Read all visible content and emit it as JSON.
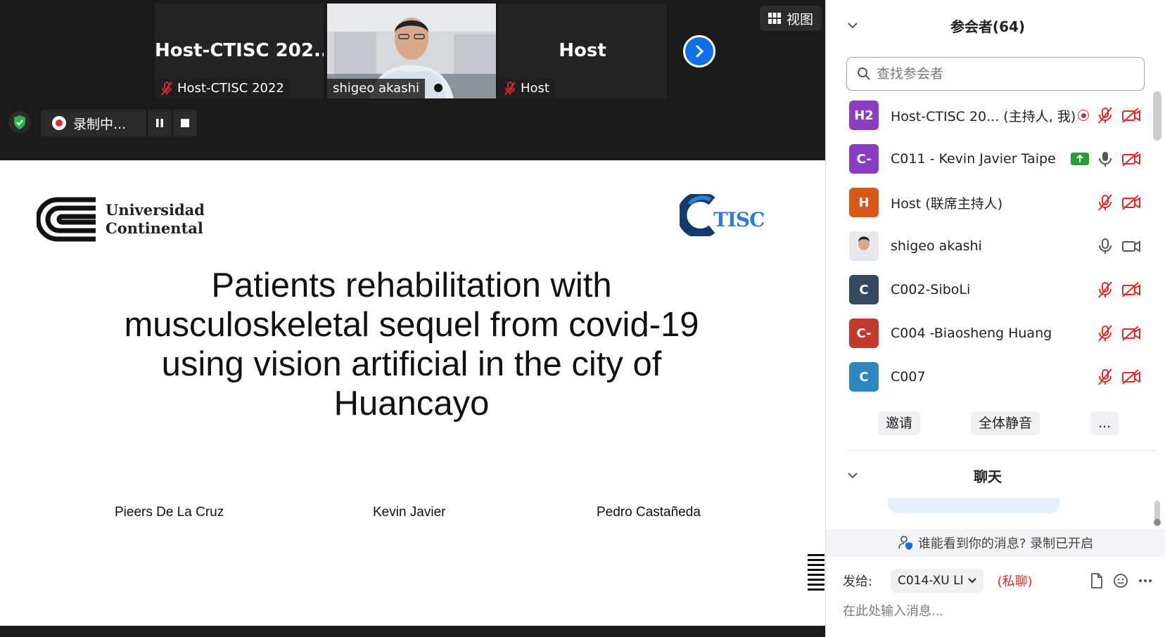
{
  "gallery": {
    "tiles": [
      {
        "big_name": "Host-CTISC  202...",
        "label": "Host-CTISC 2022",
        "muted": true
      },
      {
        "big_name": "",
        "label": "shigeo akashi",
        "muted": false
      },
      {
        "big_name": "Host",
        "label": "Host",
        "muted": true
      }
    ],
    "view_label": "视图"
  },
  "recording": {
    "status": "录制中..."
  },
  "slide": {
    "logo_uc_line1": "Universidad",
    "logo_uc_line2": "Continental",
    "logo_ctisc": "TISC",
    "title_lines": [
      "Patients rehabilitation with",
      "musculoskeletal sequel from covid-19",
      "using vision artificial in the city of",
      "Huancayo"
    ],
    "authors": [
      "Pieers De La Cruz",
      "Kevin Javier",
      "Pedro Castañeda"
    ]
  },
  "participants": {
    "header": "参会者(64)",
    "search_placeholder": "查找参会者",
    "list": [
      {
        "initials": "H2",
        "color": "#8a3cc2",
        "name": "Host-CTISC 20...",
        "role": "(主持人, 我)",
        "recording": true,
        "sharing": false,
        "mic": "muted",
        "video": "off"
      },
      {
        "initials": "C-",
        "color": "#8a3cc2",
        "name": "C011 - Kevin Javier Taipe",
        "role": "",
        "recording": false,
        "sharing": true,
        "mic": "on",
        "video": "off"
      },
      {
        "initials": "H",
        "color": "#d9581a",
        "name": "Host (联席主持人)",
        "role": "",
        "recording": false,
        "sharing": false,
        "mic": "muted",
        "video": "off"
      },
      {
        "initials": "",
        "color": "#cfcfcf",
        "name": "shigeo akashi",
        "role": "",
        "recording": false,
        "sharing": false,
        "mic": "on",
        "video": "on"
      },
      {
        "initials": "C",
        "color": "#34495e",
        "name": "C002-SiboLi",
        "role": "",
        "recording": false,
        "sharing": false,
        "mic": "muted",
        "video": "off"
      },
      {
        "initials": "C-",
        "color": "#c0392b",
        "name": "C004 -Biaosheng Huang",
        "role": "",
        "recording": false,
        "sharing": false,
        "mic": "muted",
        "video": "off"
      },
      {
        "initials": "C",
        "color": "#2e86c1",
        "name": "C007",
        "role": "",
        "recording": false,
        "sharing": false,
        "mic": "muted",
        "video": "off"
      }
    ],
    "invite_label": "邀请",
    "mute_all_label": "全体静音",
    "more_label": "..."
  },
  "chat": {
    "header": "聊天",
    "notice": "谁能看到你的消息? 录制已开启",
    "send_to_label": "发给:",
    "recipient": "C014-XU LI",
    "private_label": "(私聊)",
    "input_placeholder": "在此处输入消息..."
  },
  "colors": {
    "accent": "#0e71eb",
    "muted_red": "#e02828",
    "share_green": "#23a036"
  }
}
